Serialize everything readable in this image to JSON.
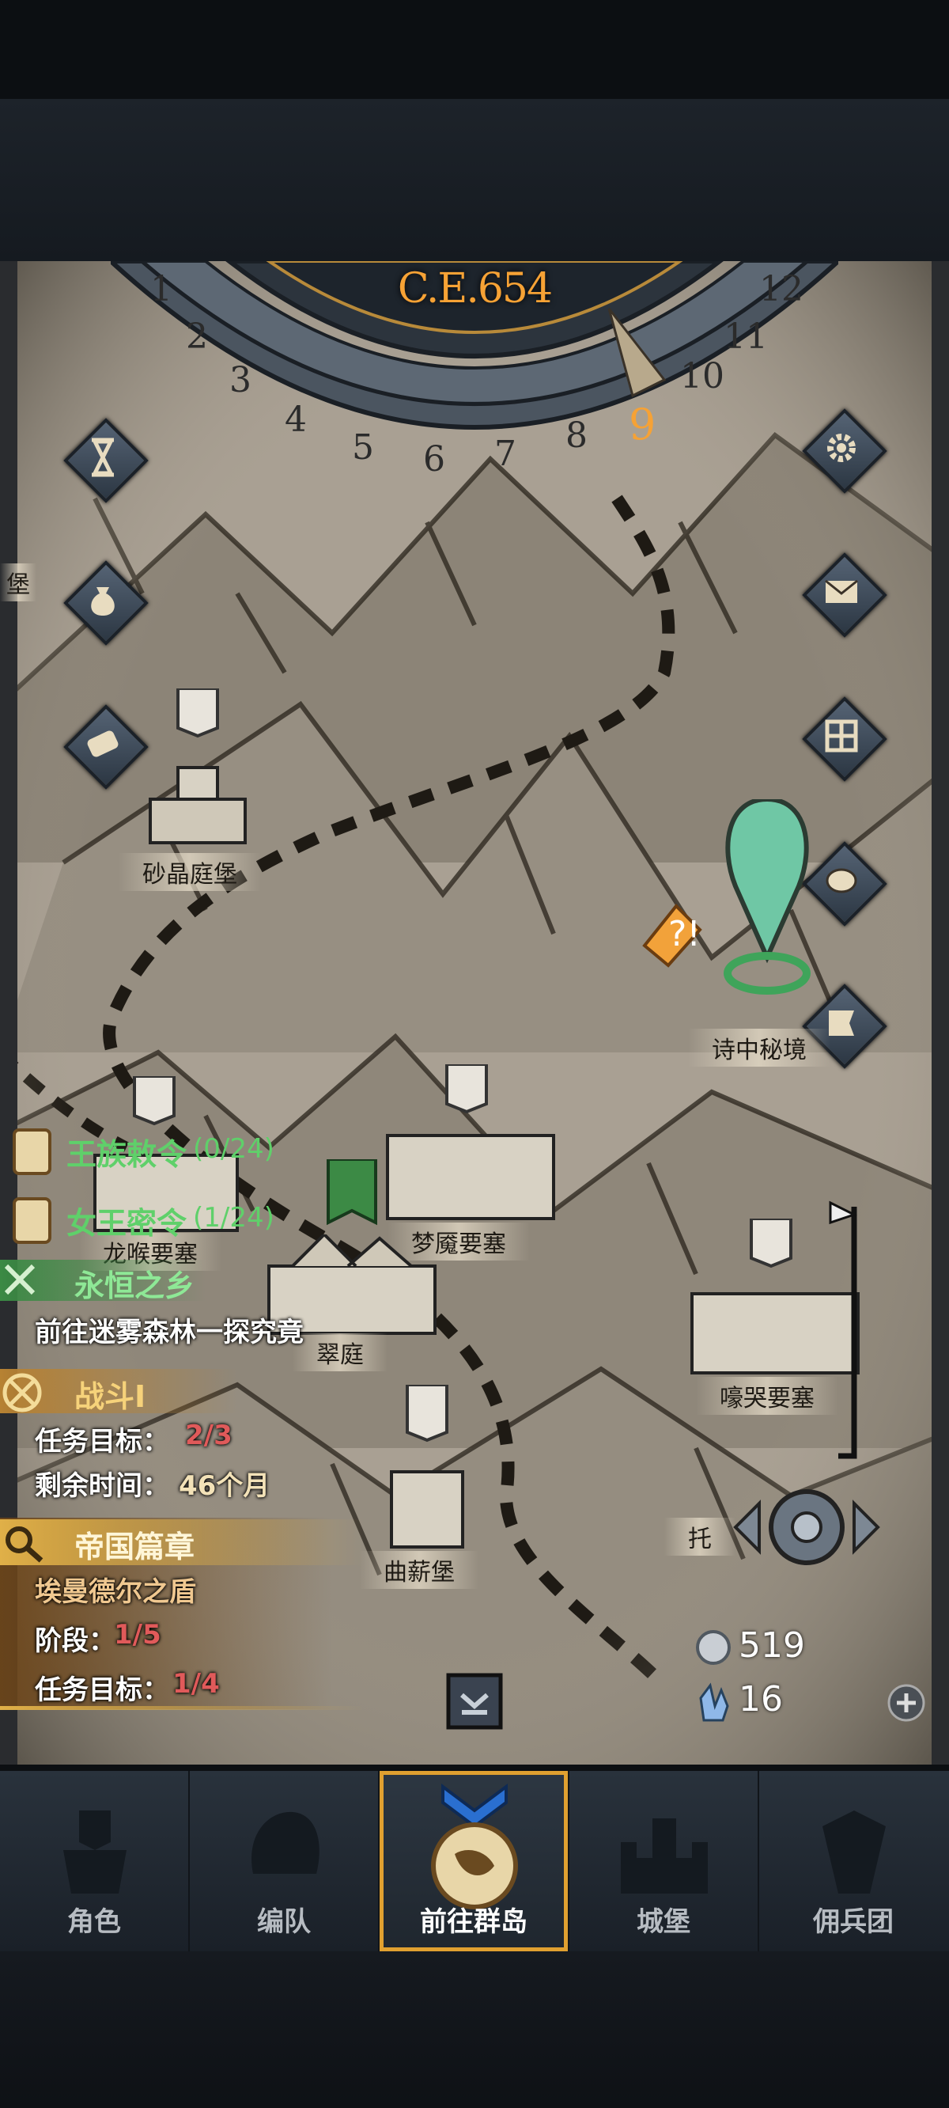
{
  "header": {
    "year": "C.E.654",
    "months": [
      "1",
      "2",
      "3",
      "4",
      "5",
      "6",
      "7",
      "8",
      "9",
      "10",
      "11",
      "12"
    ],
    "current_month": "9"
  },
  "locations": [
    {
      "name": "砂晶庭堡"
    },
    {
      "name": "诗中秘境"
    },
    {
      "name": "龙喉要塞"
    },
    {
      "name": "梦魇要塞"
    },
    {
      "name": "翠庭"
    },
    {
      "name": "嚎哭要塞"
    },
    {
      "name": "曲薪堡"
    },
    {
      "name": "托"
    },
    {
      "name": "堡"
    }
  ],
  "quests": {
    "royal_decree": {
      "title": "王族敕令",
      "progress": "(0/24)"
    },
    "queen_order": {
      "title": "女王密令",
      "progress": "(1/24)"
    },
    "eternal": {
      "title": "永恒之乡",
      "desc": "前往迷雾森林一探究竟"
    },
    "battle": {
      "title": "战斗I",
      "goal_label": "任务目标：",
      "goal_value": "2/3",
      "time_label": "剩余时间：",
      "time_value": "46个月"
    },
    "empire": {
      "title": "帝国篇章",
      "subtitle": "埃曼德尔之盾",
      "stage_label": "阶段：",
      "stage_value": "1/5",
      "goal_label": "任务目标：",
      "goal_value": "1/4"
    }
  },
  "resources": {
    "silver": "519",
    "crystal": "16"
  },
  "nav": [
    {
      "label": "角色"
    },
    {
      "label": "编队"
    },
    {
      "label": "前往群岛"
    },
    {
      "label": "城堡"
    },
    {
      "label": "佣兵团"
    }
  ],
  "colors": {
    "accent_gold": "#f6a235",
    "quest_green": "#5fd06a",
    "quest_gold": "#f0b43a",
    "red_value": "#e05a5a"
  }
}
